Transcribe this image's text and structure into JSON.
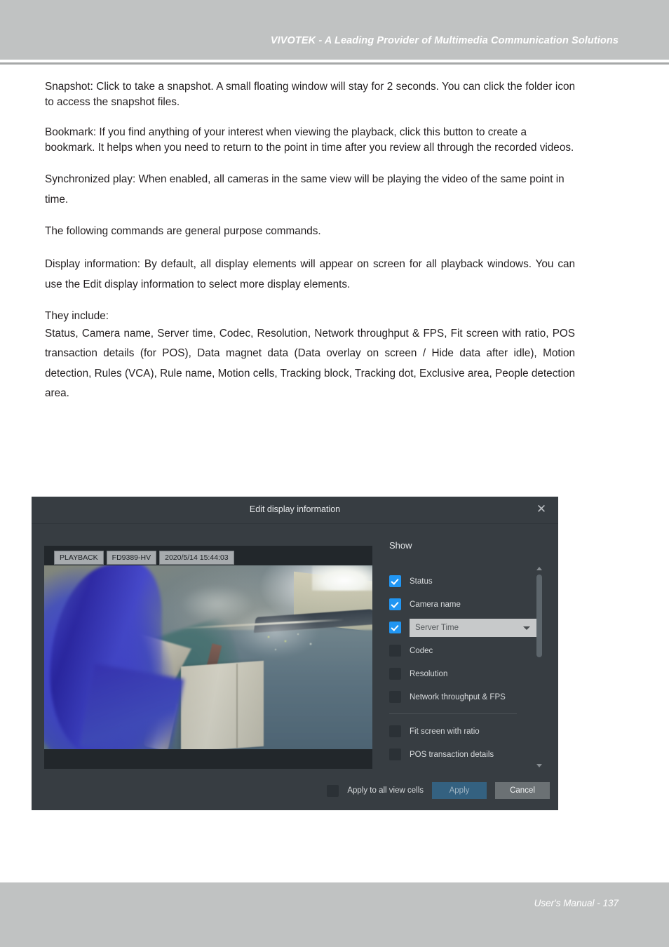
{
  "page": {
    "header_title": "VIVOTEK - A Leading Provider of Multimedia Communication Solutions",
    "footer_text": "User's Manual - 137",
    "header_band_color": "#c0c2c2",
    "body_text_color": "#231f20"
  },
  "body": {
    "p1": "Snapshot: Click to take a snapshot. A small floating window will stay for 2 seconds. You can click the folder icon to access the snapshot files.",
    "p2": "Bookmark: If you find anything of your interest when viewing the playback, click this button to create a bookmark. It helps when you need to return to the point in time after you review all through the recorded videos.",
    "p3": "Synchronized play: When enabled, all cameras in the same view will be playing the video of the same point in time.",
    "p4": "The following commands are general purpose commands.",
    "p5": "Display information: By default, all display elements will appear on screen for all playback windows. You can use the Edit display information to select more display elements.",
    "p6": "They include:",
    "p7": "Status, Camera name, Server time, Codec, Resolution, Network throughput & FPS, Fit screen with ratio, POS transaction details (for POS), Data magnet data (Data overlay on screen / Hide data after idle), Motion detection, Rules (VCA), Rule name, Motion cells, Tracking block, Tracking dot, Exclusive area, People detection area."
  },
  "dialog": {
    "title": "Edit display information",
    "close_icon": "close-icon",
    "accent_color": "#2196f3",
    "background_color": "#373d42",
    "video": {
      "osd_chips": [
        {
          "name": "status-chip",
          "label": "PLAYBACK"
        },
        {
          "name": "camera-name-chip",
          "label": "FD9389-HV"
        },
        {
          "name": "server-time-chip",
          "label": "2020/5/14 15:44:03"
        }
      ]
    },
    "panel": {
      "heading": "Show",
      "options": [
        {
          "label": "Status",
          "checked": true,
          "type": "checkbox"
        },
        {
          "label": "Camera name",
          "checked": true,
          "type": "checkbox"
        },
        {
          "label": "Server Time",
          "checked": true,
          "type": "dropdown",
          "dropdown_value": "Server Time"
        },
        {
          "label": "Codec",
          "checked": false,
          "type": "checkbox"
        },
        {
          "label": "Resolution",
          "checked": false,
          "type": "checkbox"
        },
        {
          "label": "Network throughput & FPS",
          "checked": false,
          "type": "checkbox"
        },
        {
          "label": "Fit screen with ratio",
          "checked": false,
          "type": "checkbox"
        },
        {
          "label": "POS transaction details",
          "checked": false,
          "type": "checkbox"
        }
      ],
      "scrollbar": {
        "up_icon": "chevron-up-icon",
        "down_icon": "chevron-down-icon"
      }
    },
    "footer": {
      "apply_all_label": "Apply to all view cells",
      "apply_all_checked": false,
      "apply_label": "Apply",
      "cancel_label": "Cancel"
    }
  }
}
